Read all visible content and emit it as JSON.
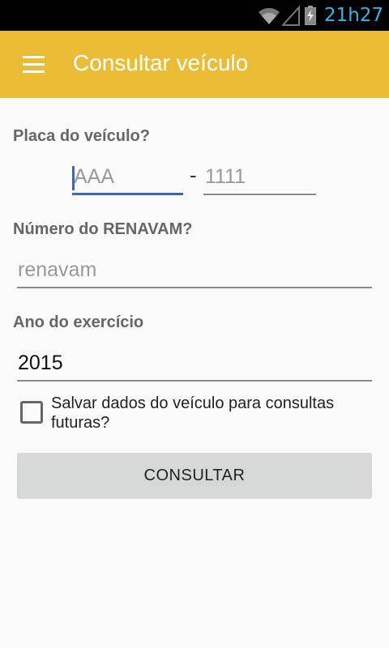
{
  "status_bar": {
    "time": "21h27",
    "icons": [
      "wifi-icon",
      "signal-icon",
      "battery-charging-icon"
    ],
    "time_color": "#33b5e5"
  },
  "app_bar": {
    "title": "Consultar veículo",
    "menu_icon": "hamburger-menu-icon",
    "color": "#ebbd36"
  },
  "form": {
    "placa_label": "Placa do veículo?",
    "placa_letters_placeholder": "AAA",
    "placa_separator": "-",
    "placa_numbers_placeholder": "1111",
    "renavam_label": "Número do RENAVAM?",
    "renavam_placeholder": "renavam",
    "ano_label": "Ano do exercício",
    "ano_value": "2015",
    "save_checkbox_label": "Salvar dados do veículo para consultas futuras?",
    "save_checked": false,
    "submit_label": "CONSULTAR"
  },
  "colors": {
    "focus_accent": "#3d65c6",
    "button_bg": "#d6d7d7"
  }
}
